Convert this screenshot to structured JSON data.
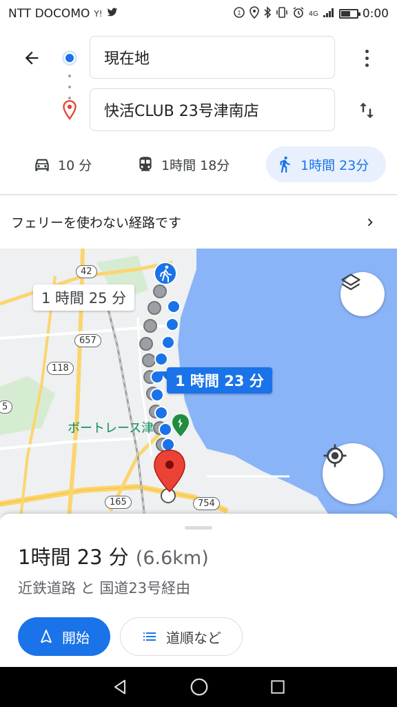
{
  "status_bar": {
    "carrier": "NTT DOCOMO",
    "time": "0:00",
    "network": "4G",
    "battery_level": 0.6
  },
  "directions": {
    "origin": "現在地",
    "destination": "快活CLUB 23号津南店"
  },
  "travel_modes": [
    {
      "mode": "car",
      "icon": "car-icon",
      "label": "10 分",
      "selected": false
    },
    {
      "mode": "transit",
      "icon": "train-icon",
      "label": "1時間 18分",
      "selected": false
    },
    {
      "mode": "walk",
      "icon": "walk-icon",
      "label": "1時間 23分",
      "selected": true
    }
  ],
  "notice": {
    "text": "フェリーを使わない経路です"
  },
  "map": {
    "alt_route_label": "1 時間 25 分",
    "route_label": "1 時間 23 分",
    "poi_label": "ボートレース津",
    "road_signs": [
      "42",
      "657",
      "118",
      "5",
      "165",
      "754"
    ],
    "colors": {
      "route": "#1a73e8",
      "alt_route": "#9aa0a6",
      "sea": "#8ab4f8",
      "destination": "#ea4335"
    }
  },
  "sheet": {
    "duration": "1時間 23 分",
    "distance": "(6.6km)",
    "via": "近鉄道路 と 国道23号経由",
    "start_label": "開始",
    "steps_label": "道順など"
  }
}
